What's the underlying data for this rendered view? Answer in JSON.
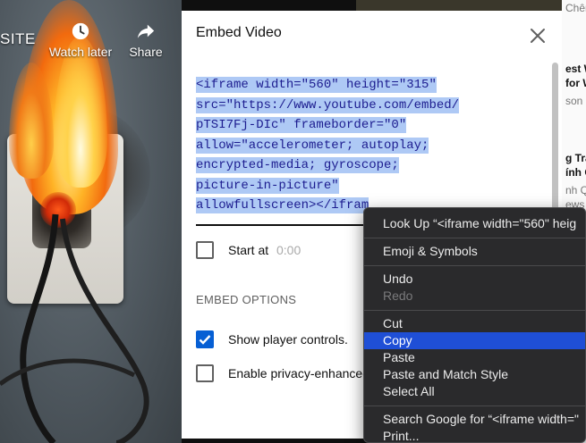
{
  "video": {
    "title_fragment": "SITE",
    "actions": [
      {
        "label": "Watch later",
        "icon": "clock-icon"
      },
      {
        "label": "Share",
        "icon": "share-icon"
      }
    ]
  },
  "background_sidebar": {
    "snippets": [
      "Chênh Vênh",
      "est W",
      "for W",
      "son",
      "g Tra",
      "ính C",
      "nh Qu",
      "ews"
    ]
  },
  "dialog": {
    "title": "Embed Video",
    "close_icon": "close-icon",
    "embed_code_lines": [
      "<iframe width=\"560\" height=\"315\"",
      "src=\"https://www.youtube.com/embed/",
      "pTSI7Fj-DIc\" frameborder=\"0\"",
      "allow=\"accelerometer; autoplay;",
      "encrypted-media; gyroscope;",
      "picture-in-picture\"",
      "allowfullscreen></ifram"
    ],
    "start_at": {
      "label": "Start at",
      "value": "0:00",
      "checked": false
    },
    "embed_options_heading": "EMBED OPTIONS",
    "options": [
      {
        "label": "Show player controls.",
        "checked": true
      },
      {
        "label": "Enable privacy-enhanced",
        "checked": false
      }
    ],
    "checkbox_color": "#065fd4",
    "selection_color": "#aec9f5"
  },
  "context_menu": {
    "items": [
      {
        "label": "Look Up “<iframe width=\"560\" heig",
        "state": "normal"
      },
      {
        "label": "Emoji & Symbols",
        "state": "normal"
      },
      {
        "label": "Undo",
        "state": "normal"
      },
      {
        "label": "Redo",
        "state": "disabled"
      },
      {
        "label": "Cut",
        "state": "normal"
      },
      {
        "label": "Copy",
        "state": "highlighted"
      },
      {
        "label": "Paste",
        "state": "normal"
      },
      {
        "label": "Paste and Match Style",
        "state": "normal"
      },
      {
        "label": "Select All",
        "state": "normal"
      },
      {
        "label": "Search Google for “<iframe width=\"",
        "state": "normal"
      },
      {
        "label": "Print...",
        "state": "normal"
      }
    ],
    "highlight_color": "#1f4fd6"
  }
}
